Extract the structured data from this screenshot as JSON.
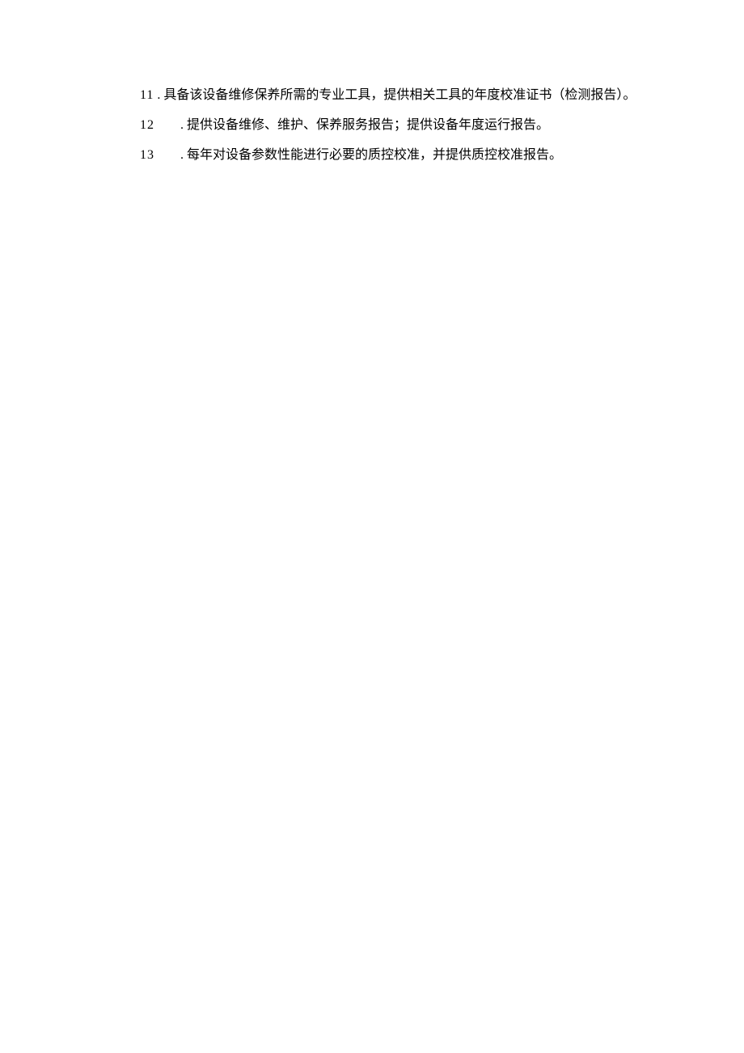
{
  "paragraphs": [
    {
      "number": "11",
      "separator": " . ",
      "text": "具备该设备维修保养所需的专业工具，提供相关工具的年度校准证书（检测报告）。"
    },
    {
      "number": "12",
      "separator": "",
      "suffix": " . ",
      "text": "提供设备维修、维护、保养服务报告；提供设备年度运行报告。"
    },
    {
      "number": "13",
      "separator": "",
      "suffix": " . ",
      "text": "每年对设备参数性能进行必要的质控校准，并提供质控校准报告。"
    }
  ]
}
